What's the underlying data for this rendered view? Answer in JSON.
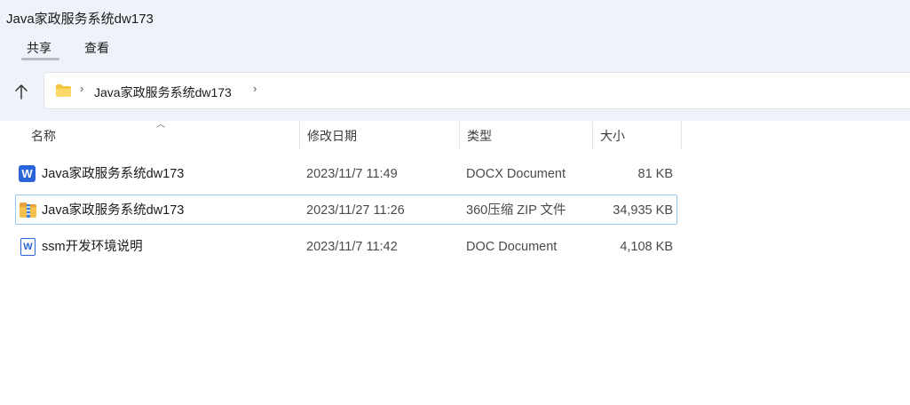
{
  "window": {
    "title": "Java家政服务系统dw173"
  },
  "ribbon": {
    "tabs": [
      {
        "label": "共享"
      },
      {
        "label": "查看"
      }
    ]
  },
  "address": {
    "breadcrumb": "Java家政服务系统dw173"
  },
  "columns": {
    "name": "名称",
    "date": "修改日期",
    "type": "类型",
    "size": "大小"
  },
  "files": [
    {
      "name": "Java家政服务系统dw173",
      "date": "2023/11/7 11:49",
      "type": "DOCX Document",
      "size": "81 KB",
      "icon": "word-docx-icon"
    },
    {
      "name": "Java家政服务系统dw173",
      "date": "2023/11/27 11:26",
      "type": "360压缩 ZIP 文件",
      "size": "34,935 KB",
      "icon": "zip-archive-icon",
      "selected": true
    },
    {
      "name": "ssm开发环境说明",
      "date": "2023/11/7 11:42",
      "type": "DOC Document",
      "size": "4,108 KB",
      "icon": "word-doc-icon"
    }
  ],
  "colors": {
    "accent": "#2b63d9",
    "selection_border": "#91c9f7",
    "folder": "#f5c542",
    "top_pane": "#eef2f9"
  }
}
